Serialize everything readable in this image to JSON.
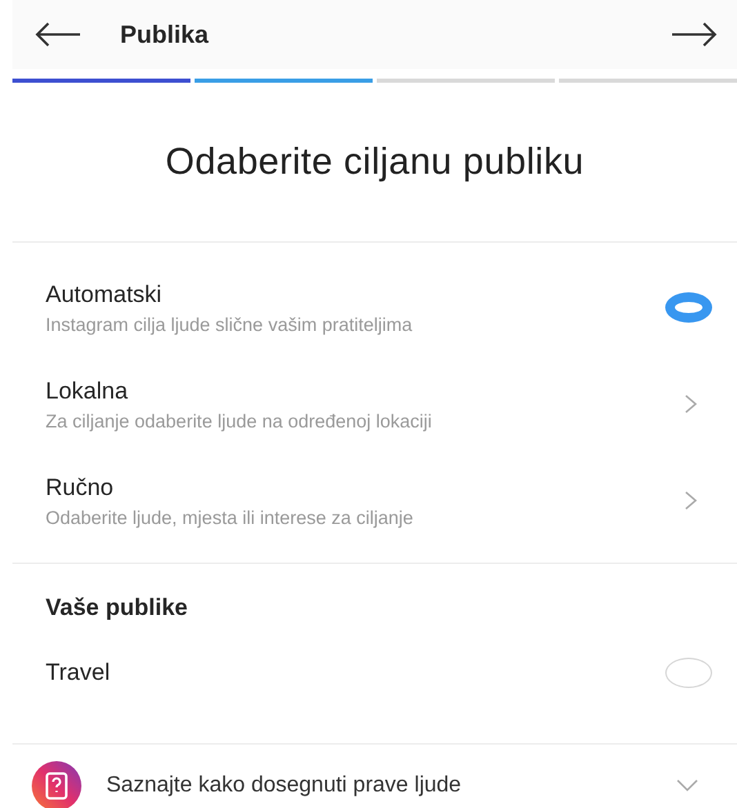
{
  "header": {
    "title": "Publika"
  },
  "progress": [
    {
      "color": "#3d4fd1"
    },
    {
      "color": "#3a9ee6"
    },
    {
      "color": "#d9d9d9"
    },
    {
      "color": "#d9d9d9"
    }
  ],
  "heading": "Odaberite ciljanu publiku",
  "options": [
    {
      "kind": "radio",
      "title": "Automatski",
      "subtitle": "Instagram cilja ljude slične vašim pratiteljima",
      "selected": true
    },
    {
      "kind": "link",
      "title": "Lokalna",
      "subtitle": "Za ciljanje odaberite ljude na određenoj lokaciji"
    },
    {
      "kind": "link",
      "title": "Ručno",
      "subtitle": "Odaberite ljude, mjesta ili interese za ciljanje"
    }
  ],
  "audiences": {
    "title": "Vaše publike",
    "items": [
      {
        "name": "Travel",
        "selected": false
      }
    ]
  },
  "help": {
    "label": "Saznajte kako dosegnuti prave ljude",
    "expanded": false
  }
}
